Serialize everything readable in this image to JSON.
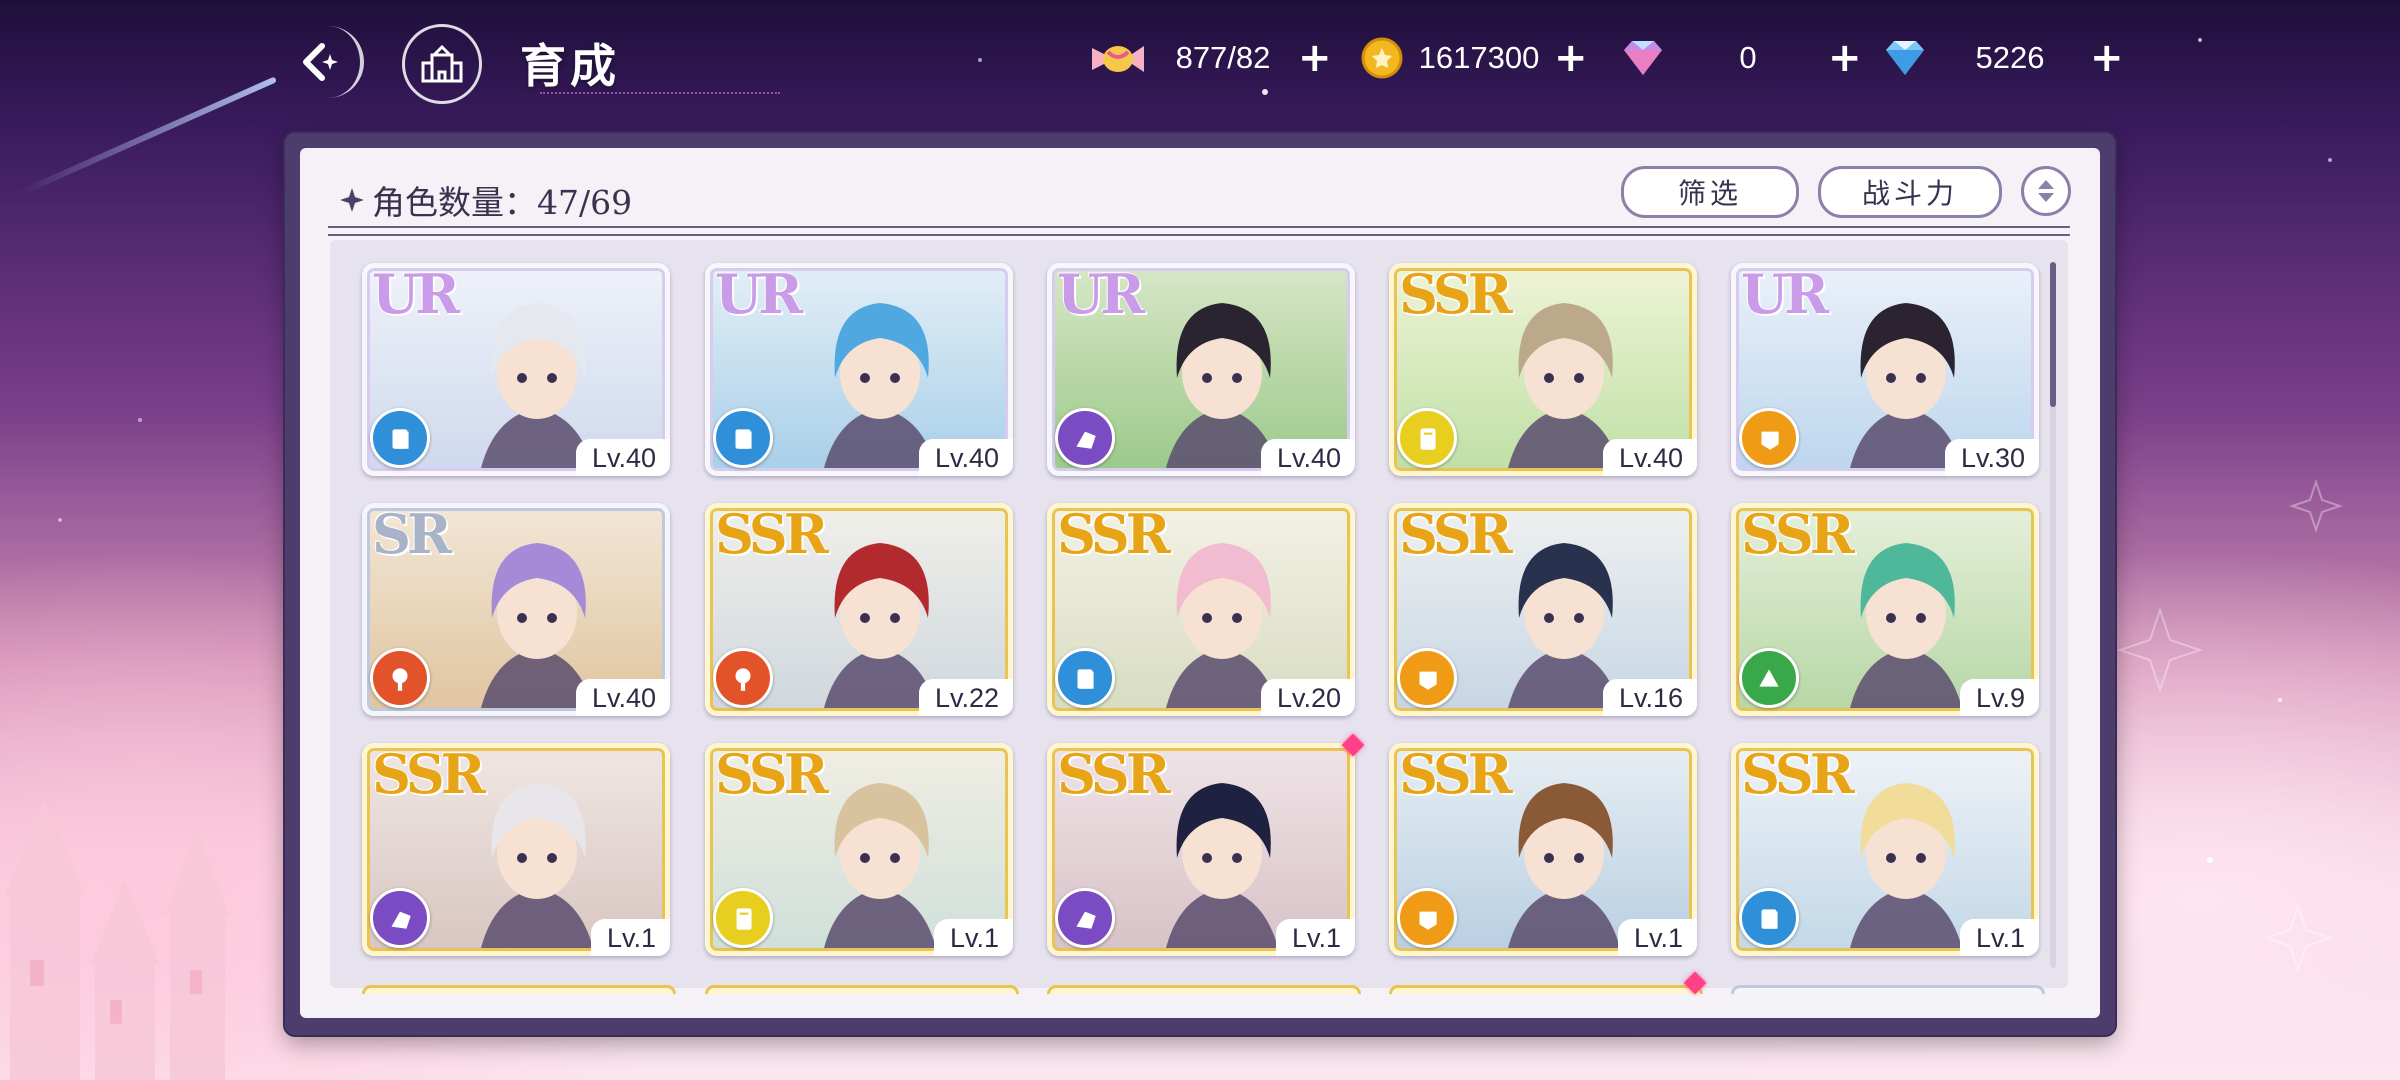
{
  "header": {
    "title": "育成",
    "back_icon": "back-arrow-icon",
    "home_icon": "castle-icon"
  },
  "resources": [
    {
      "name": "stamina-candy",
      "icon": "candy-icon",
      "value": "877/82"
    },
    {
      "name": "gold",
      "icon": "gold-coin-icon",
      "value": "1617300"
    },
    {
      "name": "paid-gem",
      "icon": "pink-gem-icon",
      "value": "0"
    },
    {
      "name": "gem",
      "icon": "blue-diamond-icon",
      "value": "5226"
    }
  ],
  "panel": {
    "count_label": "角色数量：47/69",
    "filter_label": "筛选",
    "sort_label": "战斗力"
  },
  "colors": {
    "ur": "#c99be8",
    "ssr": "#e8a417",
    "sr": "#a9b3c8",
    "element_blue": "#2f8fd8",
    "element_purple": "#7a4bc2",
    "element_yellow": "#e8cf1f",
    "element_orange": "#f09b15",
    "element_red": "#e2532a",
    "element_green": "#39a84b",
    "new_badge": "#ff3f86"
  },
  "cards": [
    {
      "rarity": "UR",
      "level": "Lv.40",
      "element": "blue",
      "bg": [
        "#cfd9ee",
        "#eef1f8"
      ],
      "hair": "#e6e8f0",
      "new": false
    },
    {
      "rarity": "UR",
      "level": "Lv.40",
      "element": "blue",
      "bg": [
        "#a8cfe9",
        "#e2eef6"
      ],
      "hair": "#4fa8e0",
      "new": false
    },
    {
      "rarity": "UR",
      "level": "Lv.40",
      "element": "purple",
      "bg": [
        "#9cc98a",
        "#d6e6c6"
      ],
      "hair": "#2a2430",
      "new": false
    },
    {
      "rarity": "SSR",
      "level": "Lv.40",
      "element": "yellow",
      "bg": [
        "#bfe0a6",
        "#eef3d6"
      ],
      "hair": "#bca98c",
      "new": false
    },
    {
      "rarity": "UR",
      "level": "Lv.30",
      "element": "orange",
      "bg": [
        "#bcd6ee",
        "#eaf0f8"
      ],
      "hair": "#2b2330",
      "new": false
    },
    {
      "rarity": "SR",
      "level": "Lv.40",
      "element": "red",
      "bg": [
        "#e0c59f",
        "#f2e6d6"
      ],
      "hair": "#a58ad8",
      "new": false
    },
    {
      "rarity": "SSR",
      "level": "Lv.22",
      "element": "red",
      "bg": [
        "#cfd7de",
        "#f0efe9"
      ],
      "hair": "#b32a2e",
      "new": false
    },
    {
      "rarity": "SSR",
      "level": "Lv.20",
      "element": "blue",
      "bg": [
        "#d8dcc2",
        "#f3f1e4"
      ],
      "hair": "#f2bcd0",
      "new": false
    },
    {
      "rarity": "SSR",
      "level": "Lv.16",
      "element": "orange",
      "bg": [
        "#c7d6e4",
        "#eef0ef"
      ],
      "hair": "#28324f",
      "new": false
    },
    {
      "rarity": "SSR",
      "level": "Lv.9",
      "element": "green",
      "bg": [
        "#b6d7a7",
        "#e6efd9"
      ],
      "hair": "#4fb89a",
      "new": false
    },
    {
      "rarity": "SSR",
      "level": "Lv.1",
      "element": "purple",
      "bg": [
        "#d8c6c2",
        "#efe6e2"
      ],
      "hair": "#e8e6ea",
      "new": false
    },
    {
      "rarity": "SSR",
      "level": "Lv.1",
      "element": "yellow",
      "bg": [
        "#cfe0d9",
        "#f0ede4"
      ],
      "hair": "#d9c29e",
      "new": false
    },
    {
      "rarity": "SSR",
      "level": "Lv.1",
      "element": "purple",
      "bg": [
        "#d7c2c7",
        "#efe3e6"
      ],
      "hair": "#1f2140",
      "new": true
    },
    {
      "rarity": "SSR",
      "level": "Lv.1",
      "element": "orange",
      "bg": [
        "#b9cfe2",
        "#e6eef2"
      ],
      "hair": "#8a5a36",
      "new": false
    },
    {
      "rarity": "SSR",
      "level": "Lv.1",
      "element": "blue",
      "bg": [
        "#c3d8e8",
        "#eef2f6"
      ],
      "hair": "#f1dc9a",
      "new": false
    }
  ],
  "next_row_new_badge": [
    false,
    false,
    false,
    true,
    false
  ]
}
